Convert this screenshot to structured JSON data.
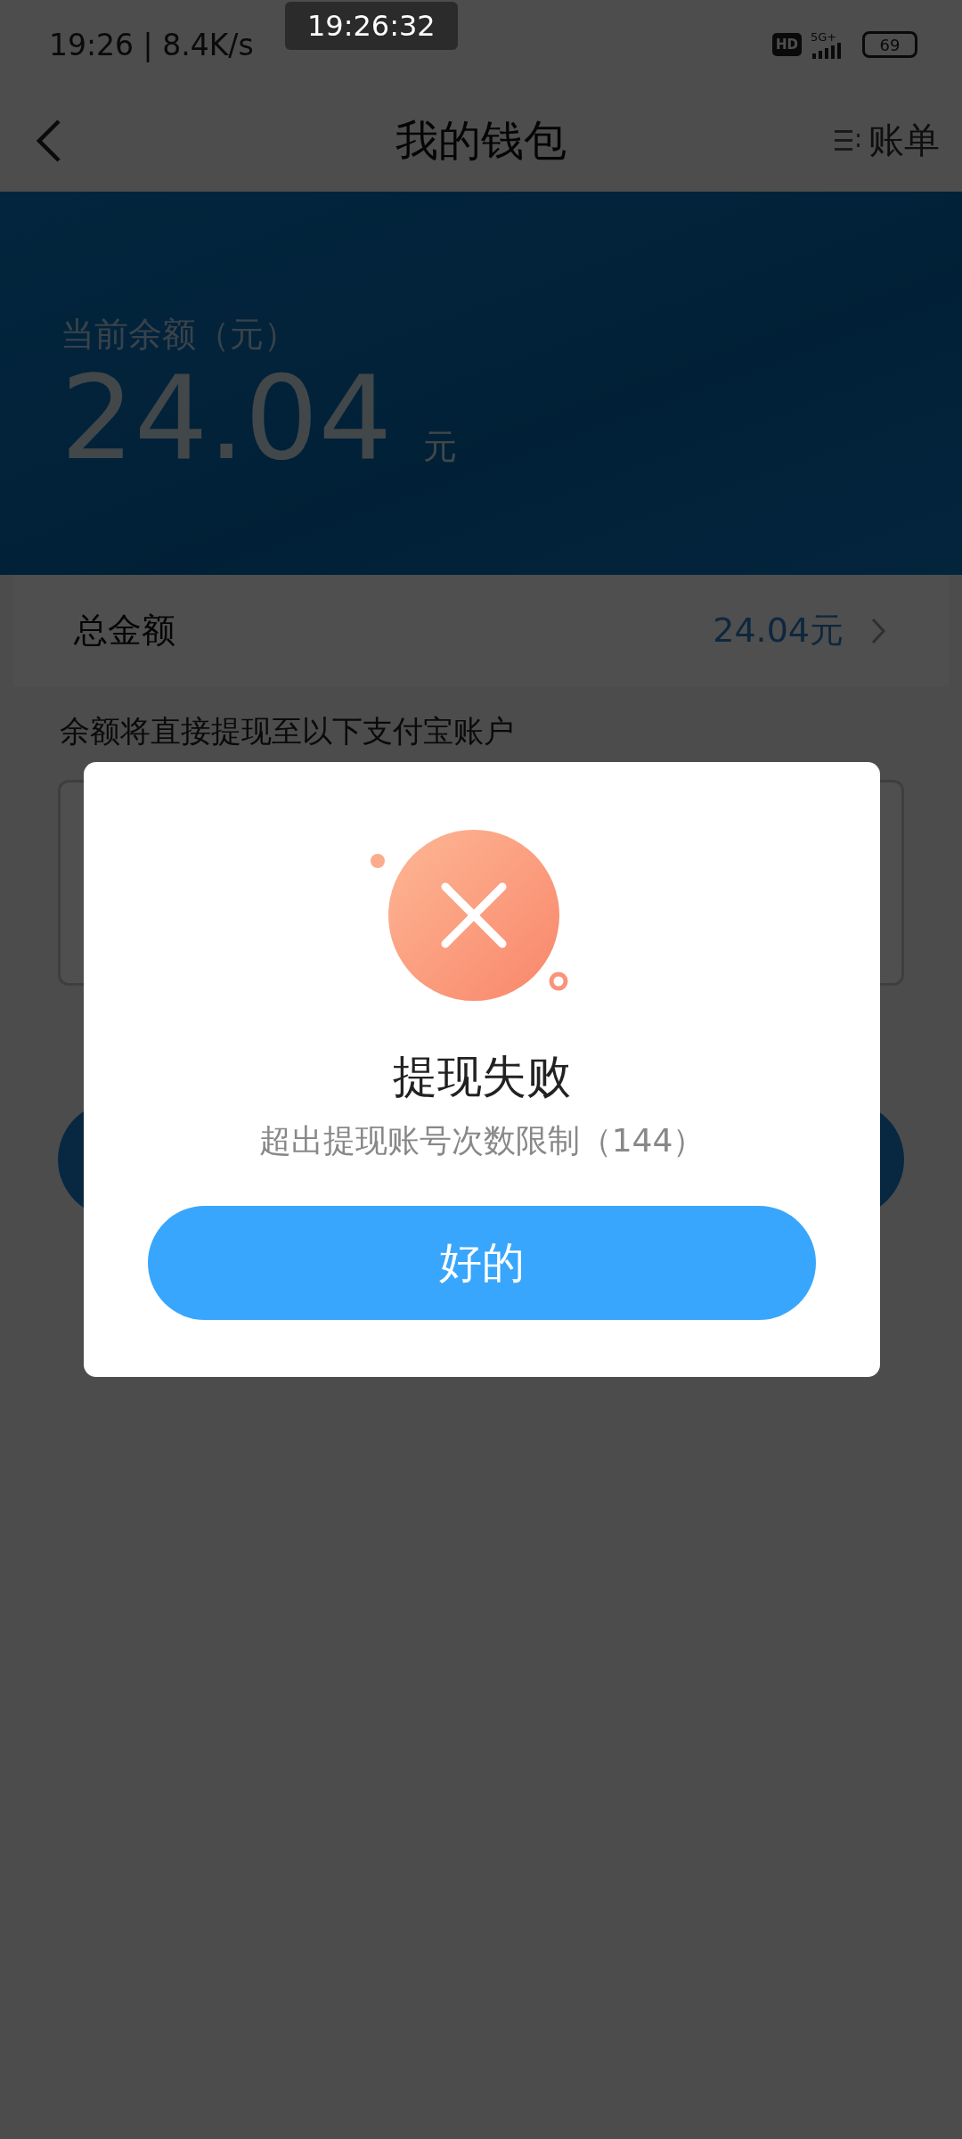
{
  "status_bar": {
    "time_speed": "19:26 | 8.4K/s",
    "hd_badge": "HD",
    "network": "5G+",
    "battery": "69"
  },
  "recorder_clock": "19:26:32",
  "header": {
    "title": "我的钱包",
    "action": "账单"
  },
  "balance": {
    "label": "当前余额（元）",
    "amount": "24.04",
    "unit": "元"
  },
  "total": {
    "label": "总金额",
    "value": "24.04元"
  },
  "account_hint": "余额将直接提现至以下支付宝账户",
  "dialog": {
    "title": "提现失败",
    "message": "超出提现账号次数限制（144）",
    "button": "好的"
  }
}
